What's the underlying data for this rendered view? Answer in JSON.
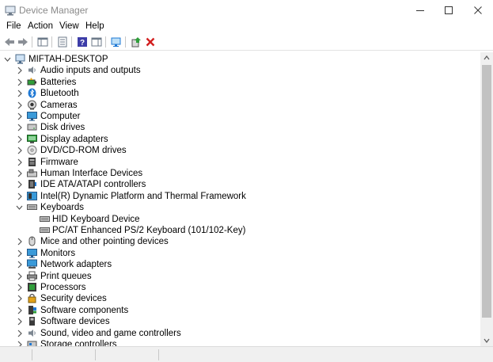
{
  "window": {
    "title": "Device Manager",
    "controls": [
      "minimize",
      "maximize",
      "close"
    ]
  },
  "menubar": {
    "items": [
      {
        "label": "File"
      },
      {
        "label": "Action"
      },
      {
        "label": "View"
      },
      {
        "label": "Help"
      }
    ]
  },
  "toolbar": {
    "buttons": [
      "back-icon",
      "forward-icon",
      "show-hide-console-tree-icon",
      "properties-icon",
      "help-icon",
      "action-pane-icon",
      "scan-hardware-icon",
      "update-driver-icon",
      "uninstall-device-icon"
    ]
  },
  "tree": {
    "root": {
      "label": "MIFTAH-DESKTOP",
      "expanded": true,
      "icon": "computer-icon"
    },
    "categories": [
      {
        "label": "Audio inputs and outputs",
        "icon": "speaker-icon",
        "expanded": false
      },
      {
        "label": "Batteries",
        "icon": "battery-icon",
        "expanded": false
      },
      {
        "label": "Bluetooth",
        "icon": "bluetooth-icon",
        "expanded": false
      },
      {
        "label": "Cameras",
        "icon": "camera-icon",
        "expanded": false
      },
      {
        "label": "Computer",
        "icon": "monitor-icon",
        "expanded": false
      },
      {
        "label": "Disk drives",
        "icon": "disk-drive-icon",
        "expanded": false
      },
      {
        "label": "Display adapters",
        "icon": "display-adapter-icon",
        "expanded": false
      },
      {
        "label": "DVD/CD-ROM drives",
        "icon": "optical-drive-icon",
        "expanded": false
      },
      {
        "label": "Firmware",
        "icon": "firmware-icon",
        "expanded": false
      },
      {
        "label": "Human Interface Devices",
        "icon": "hid-icon",
        "expanded": false
      },
      {
        "label": "IDE ATA/ATAPI controllers",
        "icon": "ide-controller-icon",
        "expanded": false
      },
      {
        "label": "Intel(R) Dynamic Platform and Thermal Framework",
        "icon": "system-device-icon",
        "expanded": false
      },
      {
        "label": "Keyboards",
        "icon": "keyboard-icon",
        "expanded": true,
        "children": [
          {
            "label": "HID Keyboard Device",
            "icon": "keyboard-icon"
          },
          {
            "label": "PC/AT Enhanced PS/2 Keyboard (101/102-Key)",
            "icon": "keyboard-icon"
          }
        ]
      },
      {
        "label": "Mice and other pointing devices",
        "icon": "mouse-icon",
        "expanded": false
      },
      {
        "label": "Monitors",
        "icon": "monitor-icon",
        "expanded": false
      },
      {
        "label": "Network adapters",
        "icon": "network-adapter-icon",
        "expanded": false
      },
      {
        "label": "Print queues",
        "icon": "printer-icon",
        "expanded": false
      },
      {
        "label": "Processors",
        "icon": "processor-icon",
        "expanded": false
      },
      {
        "label": "Security devices",
        "icon": "security-device-icon",
        "expanded": false
      },
      {
        "label": "Software components",
        "icon": "software-component-icon",
        "expanded": false
      },
      {
        "label": "Software devices",
        "icon": "software-device-icon",
        "expanded": false
      },
      {
        "label": "Sound, video and game controllers",
        "icon": "speaker-icon",
        "expanded": false
      },
      {
        "label": "Storage controllers",
        "icon": "storage-controller-icon",
        "expanded": false
      }
    ]
  },
  "colors": {
    "accent_blue": "#1e78d4",
    "uninstall_red": "#d21f1f",
    "scan_green": "#2f9e3a",
    "help_purple": "#3d3da8"
  }
}
